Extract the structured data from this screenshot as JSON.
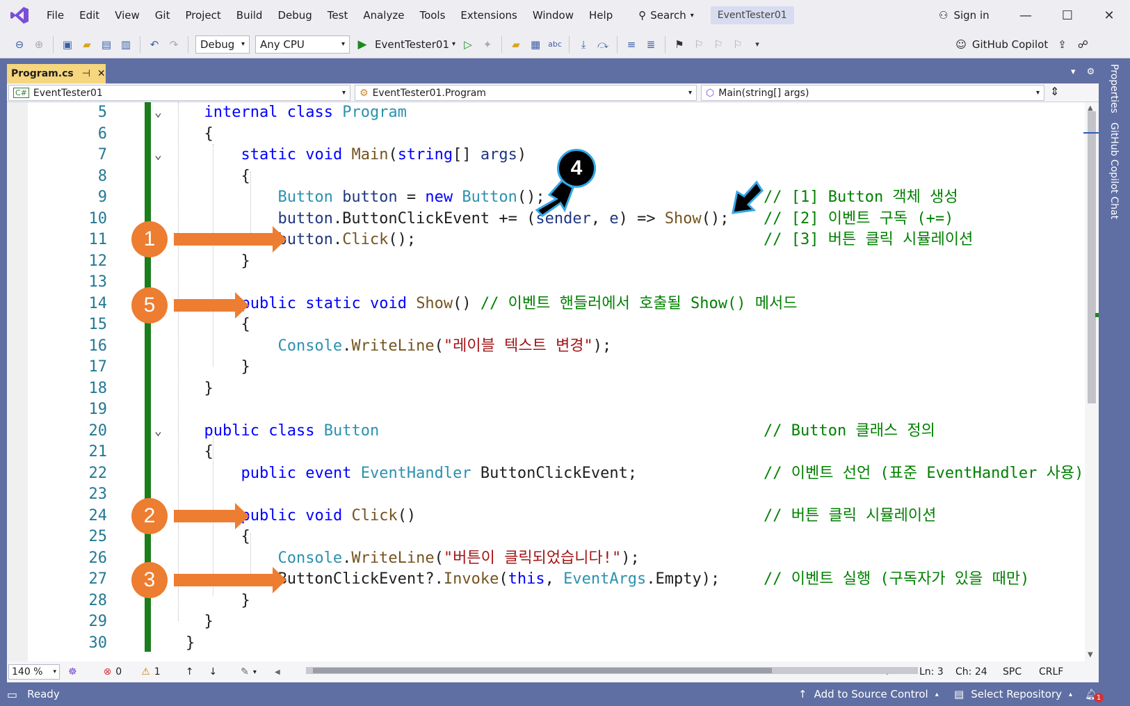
{
  "menu": [
    "File",
    "Edit",
    "View",
    "Git",
    "Project",
    "Build",
    "Debug",
    "Test",
    "Analyze",
    "Tools",
    "Extensions",
    "Window",
    "Help"
  ],
  "search_label": "Search",
  "solution_badge": "EventTester01",
  "sign_in": "Sign in",
  "toolbar": {
    "config": "Debug",
    "platform": "Any CPU",
    "start_target": "EventTester01",
    "copilot": "GitHub Copilot"
  },
  "tab": {
    "label": "Program.cs"
  },
  "right_panels": [
    "Properties",
    "GitHub Copilot Chat"
  ],
  "navbar": {
    "project": "EventTester01",
    "type": "EventTester01.Program",
    "member": "Main(string[] args)"
  },
  "code_lines": [
    {
      "n": "5",
      "fold": "⌄",
      "segs": [
        [
          "  ",
          ""
        ],
        [
          "internal",
          "kw"
        ],
        [
          " ",
          ""
        ],
        [
          "class",
          "kw"
        ],
        [
          " ",
          ""
        ],
        [
          "Program",
          "ty"
        ]
      ],
      "comment": ""
    },
    {
      "n": "6",
      "fold": "",
      "segs": [
        [
          "  {",
          ""
        ]
      ],
      "comment": ""
    },
    {
      "n": "7",
      "fold": "⌄",
      "segs": [
        [
          "      ",
          ""
        ],
        [
          "static",
          "kw"
        ],
        [
          " ",
          ""
        ],
        [
          "void",
          "kw"
        ],
        [
          " ",
          ""
        ],
        [
          "Main",
          "fn"
        ],
        [
          "(",
          ""
        ],
        [
          "string",
          "kw"
        ],
        [
          "[] ",
          ""
        ],
        [
          "args",
          "pl"
        ],
        [
          ")",
          ""
        ]
      ],
      "comment": ""
    },
    {
      "n": "8",
      "fold": "",
      "segs": [
        [
          "      {",
          ""
        ]
      ],
      "comment": ""
    },
    {
      "n": "9",
      "fold": "",
      "segs": [
        [
          "          ",
          ""
        ],
        [
          "Button",
          "ty"
        ],
        [
          " ",
          ""
        ],
        [
          "button",
          "pl"
        ],
        [
          " = ",
          ""
        ],
        [
          "new",
          "kw"
        ],
        [
          " ",
          ""
        ],
        [
          "Button",
          "ty"
        ],
        [
          "();",
          ""
        ]
      ],
      "comment": "// [1] Button 객체 생성"
    },
    {
      "n": "10",
      "fold": "",
      "segs": [
        [
          "          ",
          ""
        ],
        [
          "button",
          "pl"
        ],
        [
          ".ButtonClickEvent += (",
          ""
        ],
        [
          "sender",
          "pl"
        ],
        [
          ", ",
          ""
        ],
        [
          "e",
          "pl"
        ],
        [
          ") => ",
          ""
        ],
        [
          "Show",
          "fn"
        ],
        [
          "();",
          ""
        ]
      ],
      "comment": "// [2] 이벤트 구독 (+=)"
    },
    {
      "n": "11",
      "fold": "",
      "segs": [
        [
          "          ",
          ""
        ],
        [
          "button",
          "pl"
        ],
        [
          ".",
          ""
        ],
        [
          "Click",
          "fn"
        ],
        [
          "();",
          ""
        ]
      ],
      "comment": "// [3] 버튼 클릭 시뮬레이션"
    },
    {
      "n": "12",
      "fold": "",
      "segs": [
        [
          "      }",
          ""
        ]
      ],
      "comment": ""
    },
    {
      "n": "13",
      "fold": "",
      "segs": [],
      "comment": ""
    },
    {
      "n": "14",
      "fold": "",
      "segs": [
        [
          "      ",
          ""
        ],
        [
          "public",
          "kw"
        ],
        [
          " ",
          ""
        ],
        [
          "static",
          "kw"
        ],
        [
          " ",
          ""
        ],
        [
          "void",
          "kw"
        ],
        [
          " ",
          ""
        ],
        [
          "Show",
          "fn"
        ],
        [
          "() ",
          ""
        ],
        [
          "// 이벤트 핸들러에서 호출될 Show() 메서드",
          "cm"
        ]
      ],
      "comment": ""
    },
    {
      "n": "15",
      "fold": "",
      "segs": [
        [
          "      {",
          ""
        ]
      ],
      "comment": ""
    },
    {
      "n": "16",
      "fold": "",
      "segs": [
        [
          "          ",
          ""
        ],
        [
          "Console",
          "ty"
        ],
        [
          ".",
          ""
        ],
        [
          "WriteLine",
          "fn"
        ],
        [
          "(",
          ""
        ],
        [
          "\"레이블 텍스트 변경\"",
          "str"
        ],
        [
          ");",
          ""
        ]
      ],
      "comment": ""
    },
    {
      "n": "17",
      "fold": "",
      "segs": [
        [
          "      }",
          ""
        ]
      ],
      "comment": ""
    },
    {
      "n": "18",
      "fold": "",
      "segs": [
        [
          "  }",
          ""
        ]
      ],
      "comment": ""
    },
    {
      "n": "19",
      "fold": "",
      "segs": [],
      "comment": ""
    },
    {
      "n": "20",
      "fold": "⌄",
      "segs": [
        [
          "  ",
          ""
        ],
        [
          "public",
          "kw"
        ],
        [
          " ",
          ""
        ],
        [
          "class",
          "kw"
        ],
        [
          " ",
          ""
        ],
        [
          "Button",
          "ty"
        ]
      ],
      "comment": "// Button 클래스 정의"
    },
    {
      "n": "21",
      "fold": "",
      "segs": [
        [
          "  {",
          ""
        ]
      ],
      "comment": ""
    },
    {
      "n": "22",
      "fold": "",
      "segs": [
        [
          "      ",
          ""
        ],
        [
          "public",
          "kw"
        ],
        [
          " ",
          ""
        ],
        [
          "event",
          "kw"
        ],
        [
          " ",
          ""
        ],
        [
          "EventHandler",
          "ty"
        ],
        [
          " ButtonClickEvent;",
          ""
        ]
      ],
      "comment": "// 이벤트 선언 (표준 EventHandler 사용)"
    },
    {
      "n": "23",
      "fold": "",
      "segs": [],
      "comment": ""
    },
    {
      "n": "24",
      "fold": "",
      "segs": [
        [
          "      ",
          ""
        ],
        [
          "public",
          "kw"
        ],
        [
          " ",
          ""
        ],
        [
          "void",
          "kw"
        ],
        [
          " ",
          ""
        ],
        [
          "Click",
          "fn"
        ],
        [
          "()",
          ""
        ]
      ],
      "comment": "// 버튼 클릭 시뮬레이션"
    },
    {
      "n": "25",
      "fold": "",
      "segs": [
        [
          "      {",
          ""
        ]
      ],
      "comment": ""
    },
    {
      "n": "26",
      "fold": "",
      "segs": [
        [
          "          ",
          ""
        ],
        [
          "Console",
          "ty"
        ],
        [
          ".",
          ""
        ],
        [
          "WriteLine",
          "fn"
        ],
        [
          "(",
          ""
        ],
        [
          "\"버튼이 클릭되었습니다!\"",
          "str"
        ],
        [
          ");",
          ""
        ]
      ],
      "comment": ""
    },
    {
      "n": "27",
      "fold": "",
      "segs": [
        [
          "          ButtonClickEvent?.",
          ""
        ],
        [
          "Invoke",
          "fn"
        ],
        [
          "(",
          ""
        ],
        [
          "this",
          "kw"
        ],
        [
          ", ",
          ""
        ],
        [
          "EventArgs",
          "ty"
        ],
        [
          ".Empty);",
          ""
        ]
      ],
      "comment": "// 이벤트 실행 (구독자가 있을 때만)"
    },
    {
      "n": "28",
      "fold": "",
      "segs": [
        [
          "      }",
          ""
        ]
      ],
      "comment": ""
    },
    {
      "n": "29",
      "fold": "",
      "segs": [
        [
          "  }",
          ""
        ]
      ],
      "comment": ""
    },
    {
      "n": "30",
      "fold": "",
      "segs": [
        [
          "}",
          ""
        ]
      ],
      "comment": ""
    }
  ],
  "markers": [
    "1",
    "2",
    "3",
    "4",
    "5"
  ],
  "editor_status": {
    "zoom": "140 %",
    "errors": "0",
    "warnings": "1",
    "ln": "Ln: 3",
    "ch": "Ch: 24",
    "spc": "SPC",
    "eol": "CRLF"
  },
  "status": {
    "ready": "Ready",
    "source_control": "Add to Source Control",
    "repo": "Select Repository",
    "notifications": "1"
  },
  "colors": {
    "accent": "#5f6fa3",
    "marker": "#ed7d31",
    "tab_active": "#f6d67e",
    "change_bar": "#1b7d1b"
  }
}
